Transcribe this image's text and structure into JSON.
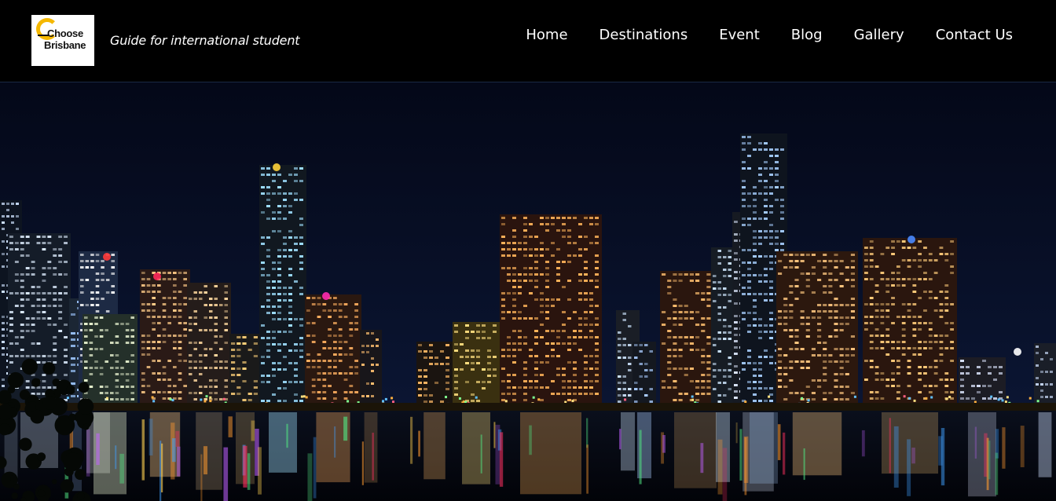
{
  "header": {
    "logo": {
      "line1": "Choose",
      "line2": "Brisbane"
    },
    "tagline": "Guide for international student"
  },
  "nav": {
    "items": [
      {
        "label": "Home"
      },
      {
        "label": "Destinations"
      },
      {
        "label": "Event"
      },
      {
        "label": "Blog"
      },
      {
        "label": "Gallery"
      },
      {
        "label": "Contact Us"
      }
    ]
  },
  "hero": {
    "image_subject": "Brisbane city skyline at night reflected in river",
    "colors": {
      "sky": "#050a1e",
      "water": "#03060f",
      "accent": "#f5b800"
    }
  }
}
